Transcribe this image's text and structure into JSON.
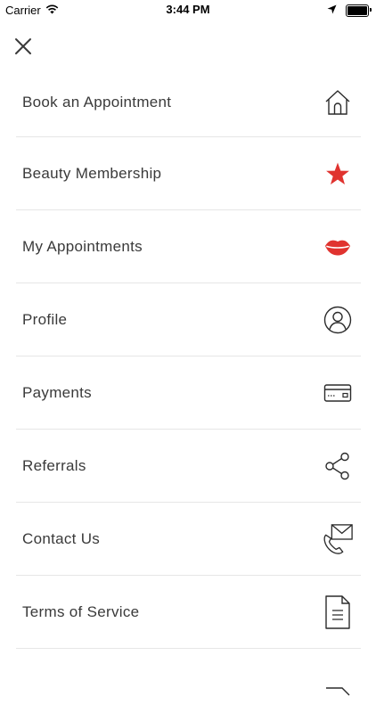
{
  "status_bar": {
    "carrier": "Carrier",
    "time": "3:44 PM",
    "battery_level": 1.0
  },
  "menu": {
    "close_icon": "close-icon",
    "items": [
      {
        "label": "Book an Appointment",
        "icon": "home-icon"
      },
      {
        "label": "Beauty Membership",
        "icon": "star-icon"
      },
      {
        "label": "My Appointments",
        "icon": "lips-icon"
      },
      {
        "label": "Profile",
        "icon": "user-circle-icon"
      },
      {
        "label": "Payments",
        "icon": "credit-card-icon"
      },
      {
        "label": "Referrals",
        "icon": "share-icon"
      },
      {
        "label": "Contact Us",
        "icon": "phone-mail-icon"
      },
      {
        "label": "Terms of Service",
        "icon": "document-icon"
      }
    ]
  },
  "colors": {
    "accent": "#e0332f",
    "text": "#3a3a3a",
    "divider": "#e6e6e6",
    "icon_stroke": "#2b2b2b"
  }
}
